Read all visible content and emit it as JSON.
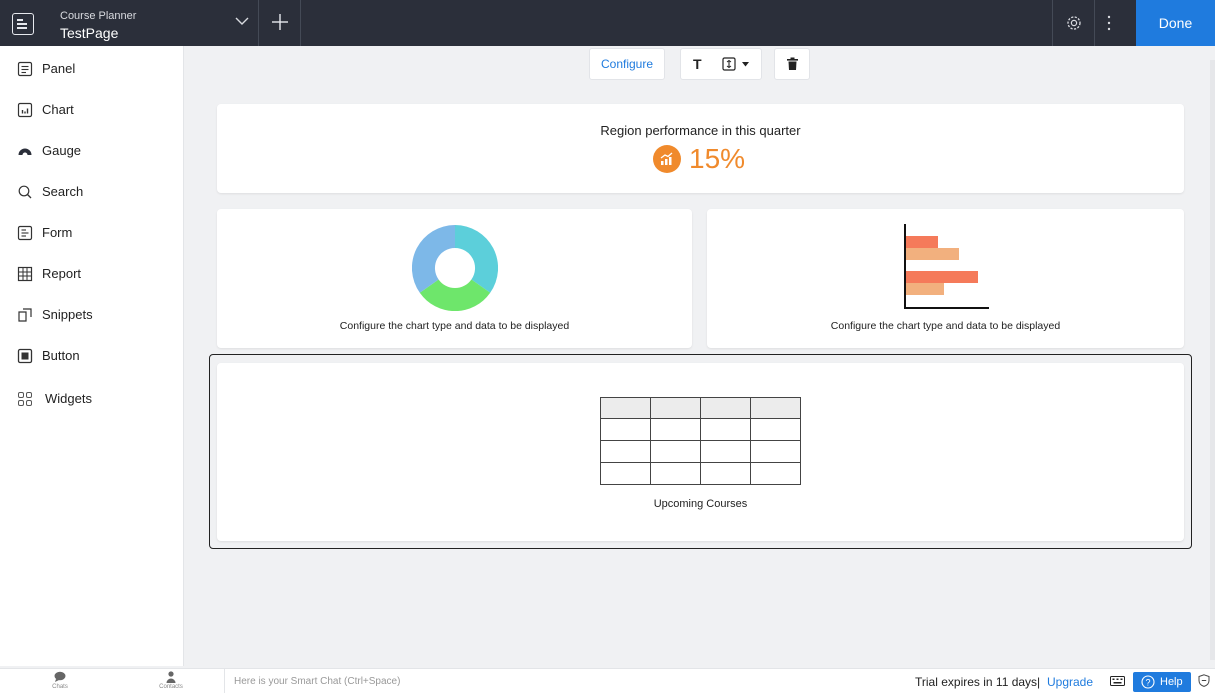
{
  "header": {
    "app_title": "Course Planner",
    "page_name": "TestPage",
    "done_label": "Done"
  },
  "sidebar": {
    "items": [
      {
        "label": "Panel",
        "icon": "panel-icon"
      },
      {
        "label": "Chart",
        "icon": "chart-icon"
      },
      {
        "label": "Gauge",
        "icon": "gauge-icon"
      },
      {
        "label": "Search",
        "icon": "search-icon"
      },
      {
        "label": "Form",
        "icon": "form-icon"
      },
      {
        "label": "Report",
        "icon": "report-icon"
      },
      {
        "label": "Snippets",
        "icon": "snippets-icon"
      },
      {
        "label": "Button",
        "icon": "button-icon"
      },
      {
        "label": "Widgets",
        "icon": "widgets-icon"
      }
    ]
  },
  "toolbar": {
    "configure_label": "Configure",
    "text_tool_label": "T"
  },
  "kpi": {
    "title": "Region performance in this quarter",
    "value": "15%",
    "accent_color": "#f08a2c"
  },
  "charts": {
    "left_caption": "Configure the chart type and data to be displayed",
    "right_caption": "Configure the chart type and data to be displayed"
  },
  "report": {
    "caption": "Upcoming Courses"
  },
  "footer": {
    "chats_label": "Chats",
    "contacts_label": "Contacts",
    "smart_chat_placeholder": "Here is your Smart Chat (Ctrl+Space)",
    "trial_text": "Trial expires in 11 days",
    "separator": "|",
    "upgrade_label": "Upgrade",
    "help_label": "Help"
  },
  "colors": {
    "topbar": "#2b2f3a",
    "accent_blue": "#1f7bde",
    "bar_primary": "#f57a5a",
    "bar_secondary": "#f2b07e"
  }
}
